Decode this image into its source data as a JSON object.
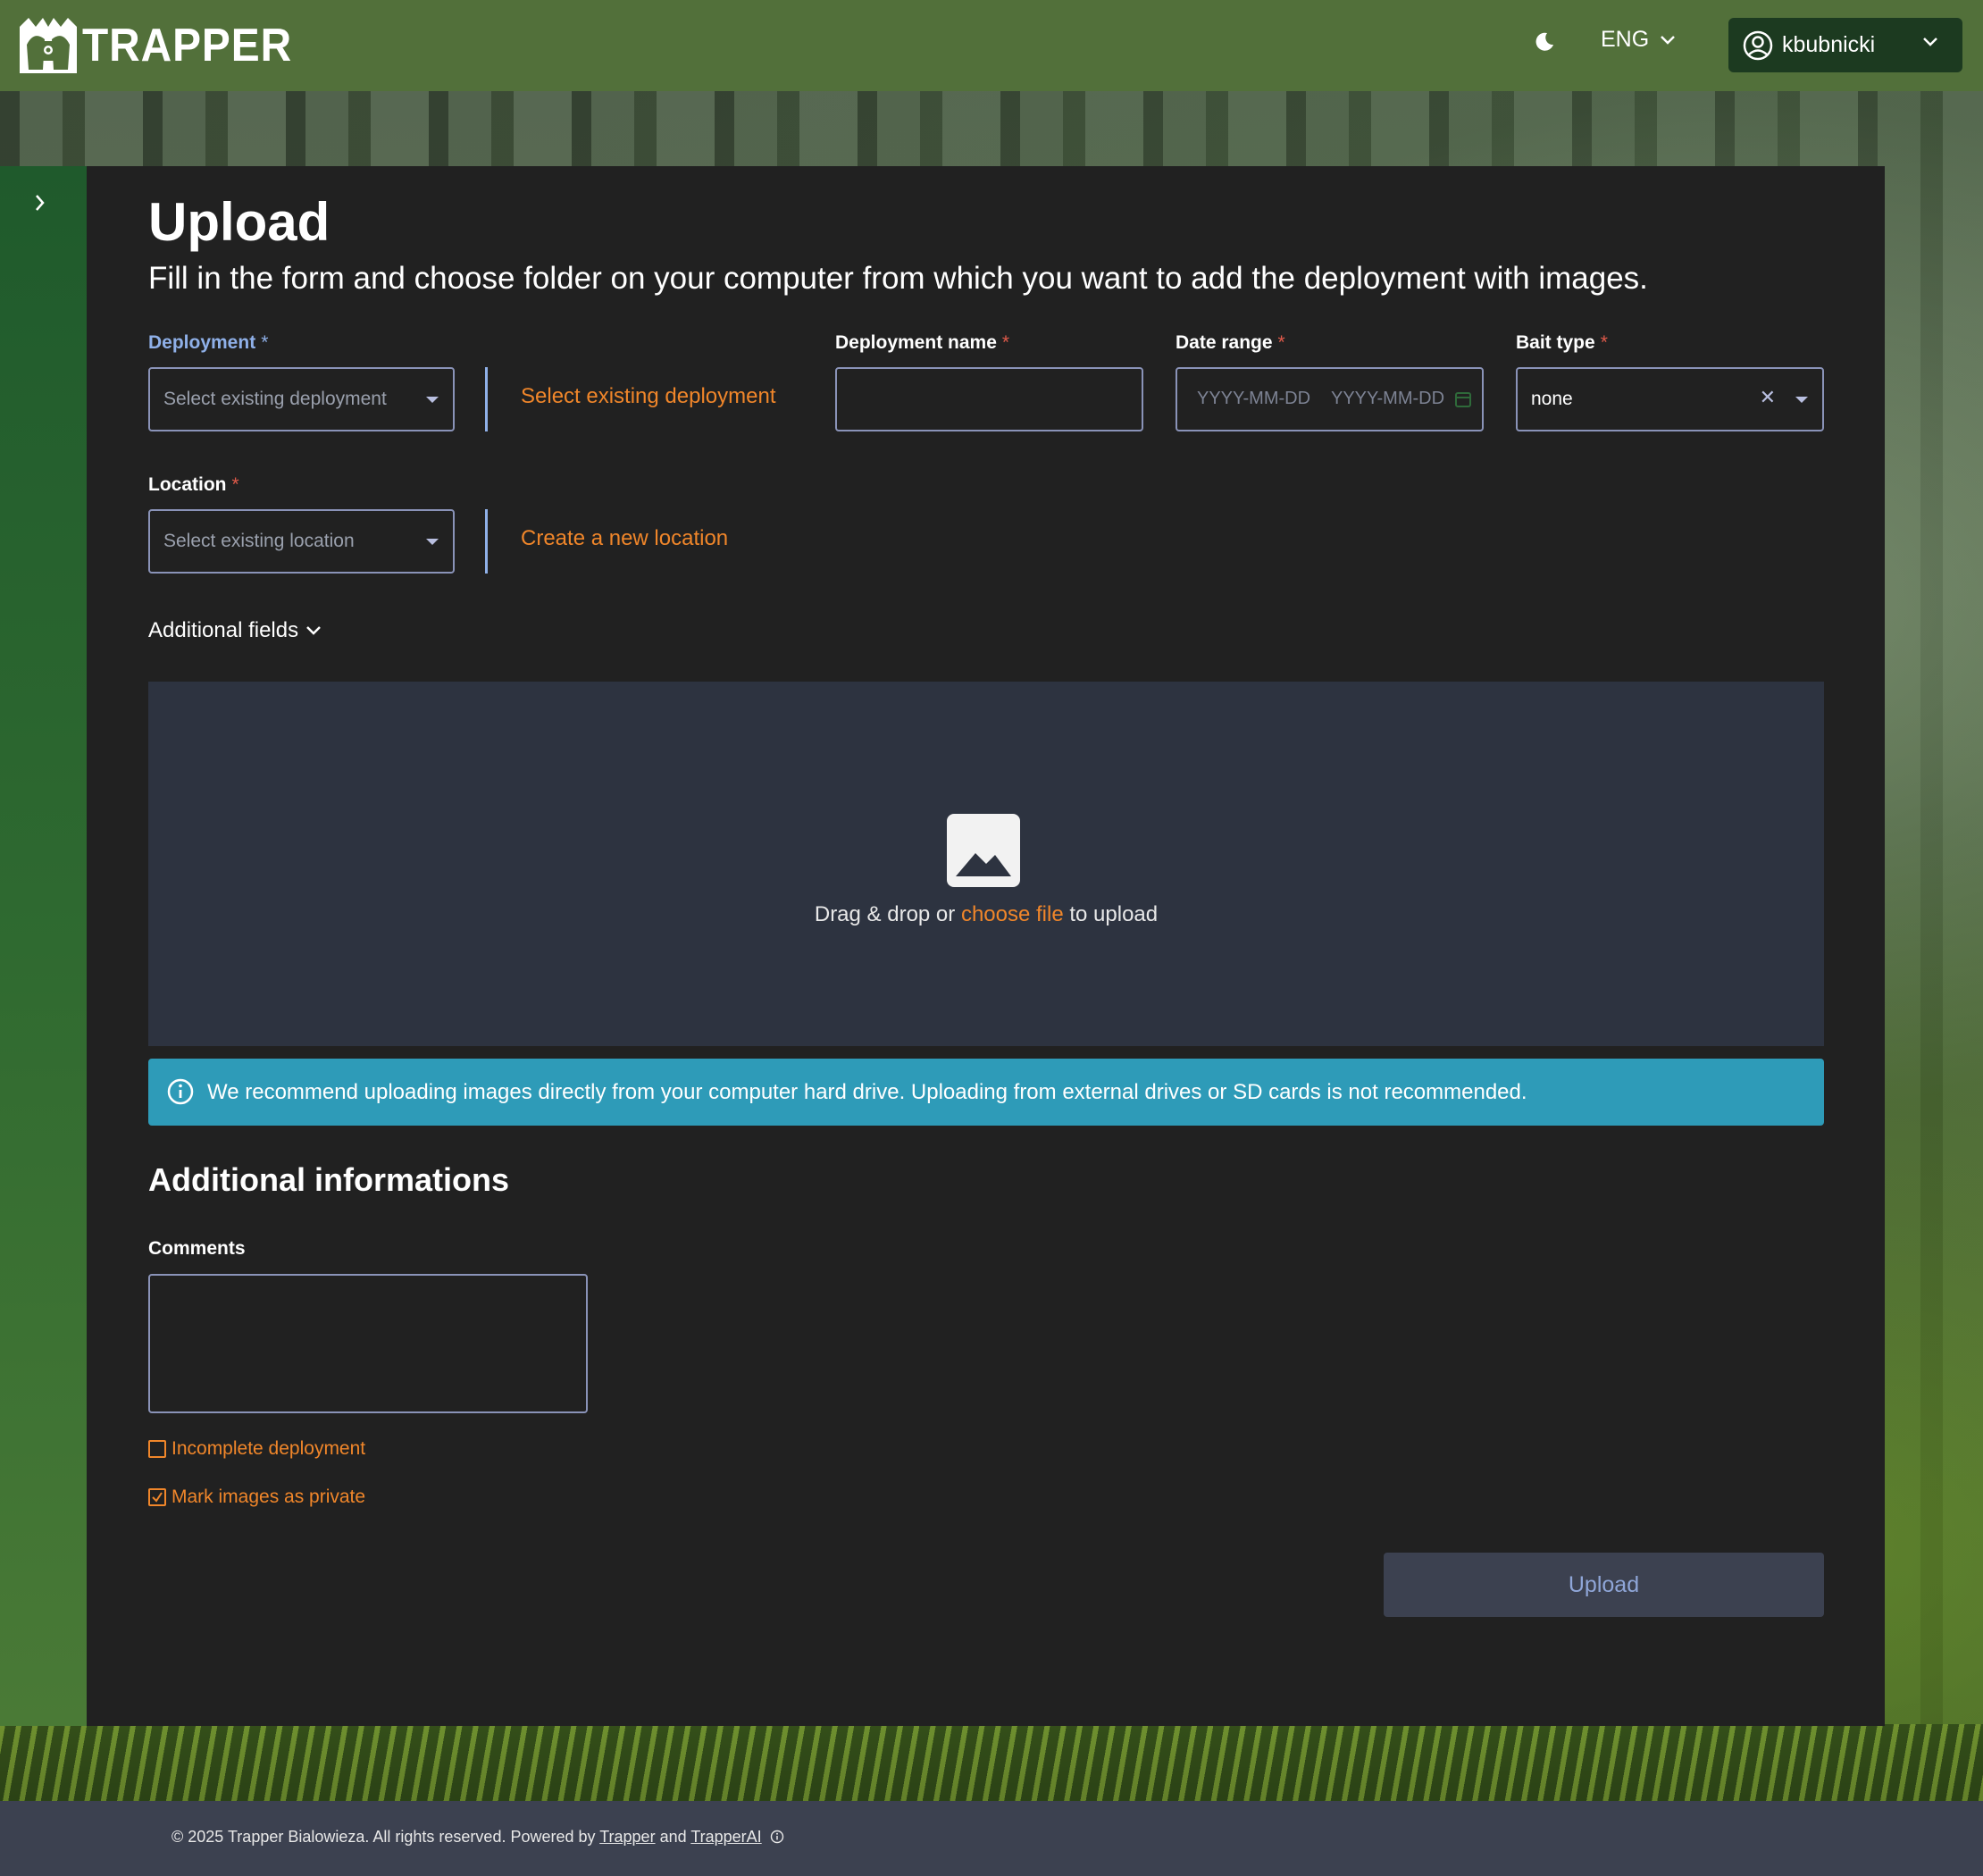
{
  "header": {
    "brand": "TRAPPER",
    "language": "ENG",
    "username": "kbubnicki"
  },
  "page": {
    "title": "Upload",
    "subtitle": "Fill in the form and choose folder on your computer from which you want to add the deployment with images."
  },
  "form": {
    "deployment": {
      "label": "Deployment",
      "required_mark": "*",
      "placeholder": "Select existing deployment",
      "link": "Select existing deployment"
    },
    "deployment_name": {
      "label": "Deployment name",
      "required_mark": "*",
      "value": ""
    },
    "date_range": {
      "label": "Date range",
      "required_mark": "*",
      "start_placeholder": "YYYY-MM-DD",
      "end_placeholder": "YYYY-MM-DD"
    },
    "bait_type": {
      "label": "Bait type",
      "required_mark": "*",
      "value": "none"
    },
    "location": {
      "label": "Location",
      "required_mark": "*",
      "placeholder": "Select existing location",
      "link": "Create a new location"
    },
    "additional_fields": "Additional fields"
  },
  "dropzone": {
    "text_before": "Drag & drop or",
    "link": "choose file",
    "text_after": "to upload"
  },
  "info": {
    "message": "We recommend uploading images directly from your computer hard drive. Uploading from external drives or SD cards is not recommended."
  },
  "additional": {
    "title": "Additional informations",
    "comments_label": "Comments",
    "comments_value": "",
    "incomplete_deployment": {
      "label": "Incomplete deployment",
      "checked": false
    },
    "mark_private": {
      "label": "Mark images as private",
      "checked": true
    }
  },
  "actions": {
    "upload": "Upload"
  },
  "footer": {
    "copyright": "© 2025 Trapper Bialowieza. All rights reserved. Powered by",
    "link1": "Trapper",
    "and": "and",
    "link2": "TrapperAI"
  },
  "colors": {
    "header": "#52703a",
    "panel": "#212121",
    "accent_orange": "#f0862a",
    "info_bar": "#2e9bb8",
    "footer": "#3c4150"
  },
  "icons": [
    "logo-icon",
    "moon-icon",
    "chevron-down-icon",
    "user-circle-icon",
    "chevron-right-icon",
    "caret-down-icon",
    "clear-icon",
    "calendar-icon",
    "image-icon",
    "info-icon",
    "checkbox-icon"
  ]
}
